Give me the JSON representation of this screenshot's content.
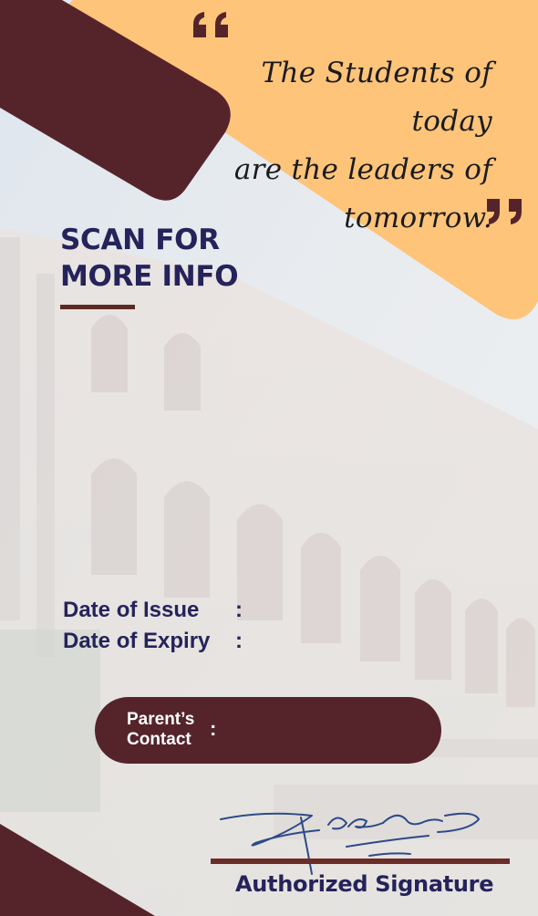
{
  "quote": {
    "lines": [
      "The Students of today",
      "are the leaders of",
      "tomorrow."
    ]
  },
  "scan": {
    "line1": "SCAN FOR",
    "line2": "MORE INFO"
  },
  "fields": {
    "issue_label": "Date of Issue",
    "issue_colon": ":",
    "expiry_label": "Date of Expiry",
    "expiry_colon": ":"
  },
  "contact": {
    "label_line1": "Parent’s",
    "label_line2": "Contact",
    "colon": ":"
  },
  "signature": {
    "label": "Authorized Signature"
  },
  "colors": {
    "maroon": "#55242b",
    "peach": "#fdc47a",
    "navy": "#25235a",
    "brown_line": "#6b2d28"
  },
  "icons": [
    "open-quote-icon",
    "close-quote-icon",
    "handwritten-signature"
  ]
}
